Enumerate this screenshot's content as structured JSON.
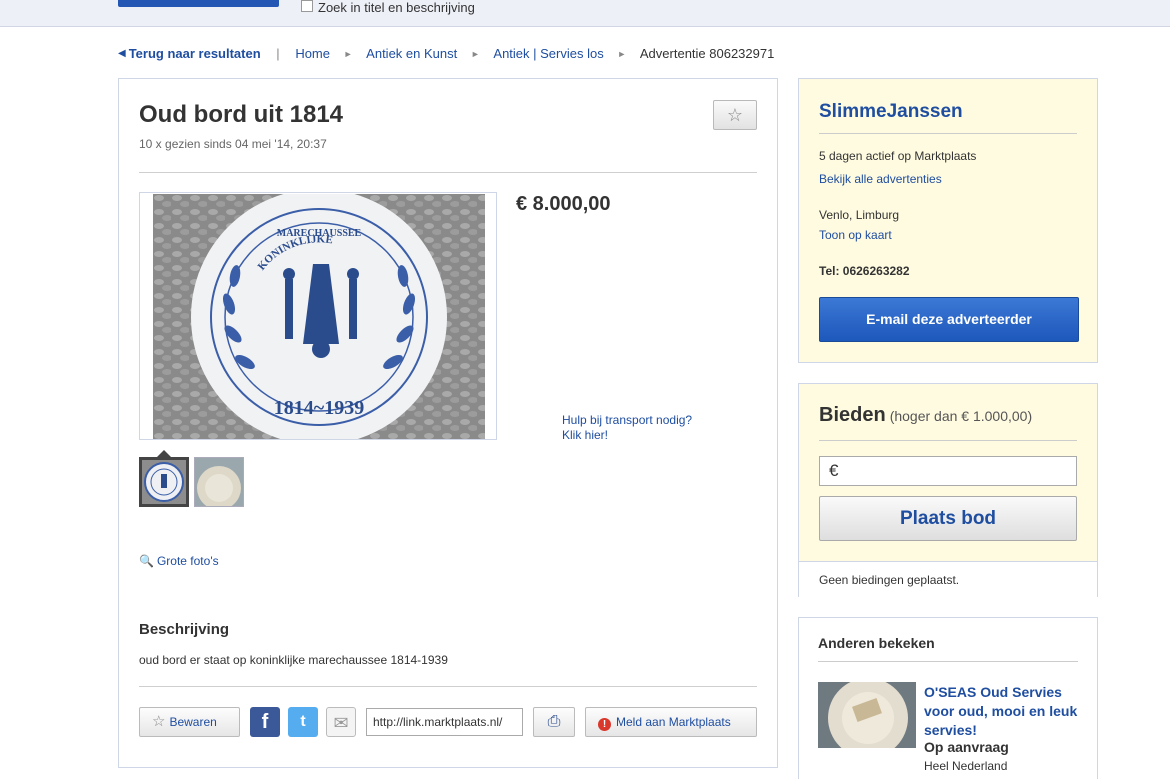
{
  "topbar": {
    "search_in_title_desc": "Zoek in titel en beschrijving"
  },
  "breadcrumb": {
    "back": "Terug naar resultaten",
    "items": [
      "Home",
      "Antiek en Kunst",
      "Antiek | Servies los"
    ],
    "current": "Advertentie 806232971"
  },
  "listing": {
    "title": "Oud bord uit 1814",
    "views": "10 x gezien sinds 04 mei '14, 20:37",
    "price": "€ 8.000,00",
    "transport_line1": "Hulp bij transport nodig?",
    "transport_line2": "Klik hier!",
    "big_photos": "Grote foto's",
    "description_heading": "Beschrijving",
    "description": "oud bord er staat op koninklijke marechaussee 1814-1939",
    "photo_text_top_1": "KONINKLIJKE",
    "photo_text_top_2": "MARECHAUSSEE",
    "photo_text_bottom": "1814~1939"
  },
  "actions": {
    "save": "Bewaren",
    "share_url": "http://link.marktplaats.nl/",
    "report": "Meld aan Marktplaats"
  },
  "seller": {
    "name": "SlimmeJanssen",
    "active": "5 dagen actief op Marktplaats",
    "all_ads": "Bekijk alle advertenties",
    "location": "Venlo, Limburg",
    "show_map": "Toon op kaart",
    "phone": "Tel: 0626263282",
    "email_button": "E-mail deze adverteerder"
  },
  "bid": {
    "title": "Bieden",
    "subtitle": "(hoger dan € 1.000,00)",
    "currency": "€",
    "button": "Plaats bod",
    "status": "Geen biedingen geplaatst."
  },
  "others": {
    "heading": "Anderen bekeken",
    "item_title": "O'SEAS Oud Servies voor oud, mooi en leuk servies!",
    "item_price": "Op aanvraag",
    "item_location": "Heel Nederland"
  },
  "colors": {
    "link": "#1f4ea0",
    "primary_button": "#2357b3",
    "seller_panel_bg": "#fffbe1",
    "plate_blue": "#3b5ea8"
  },
  "icons": [
    "star-icon",
    "facebook-icon",
    "twitter-icon",
    "mail-icon",
    "print-icon",
    "warning-icon",
    "magnifier-icon"
  ]
}
